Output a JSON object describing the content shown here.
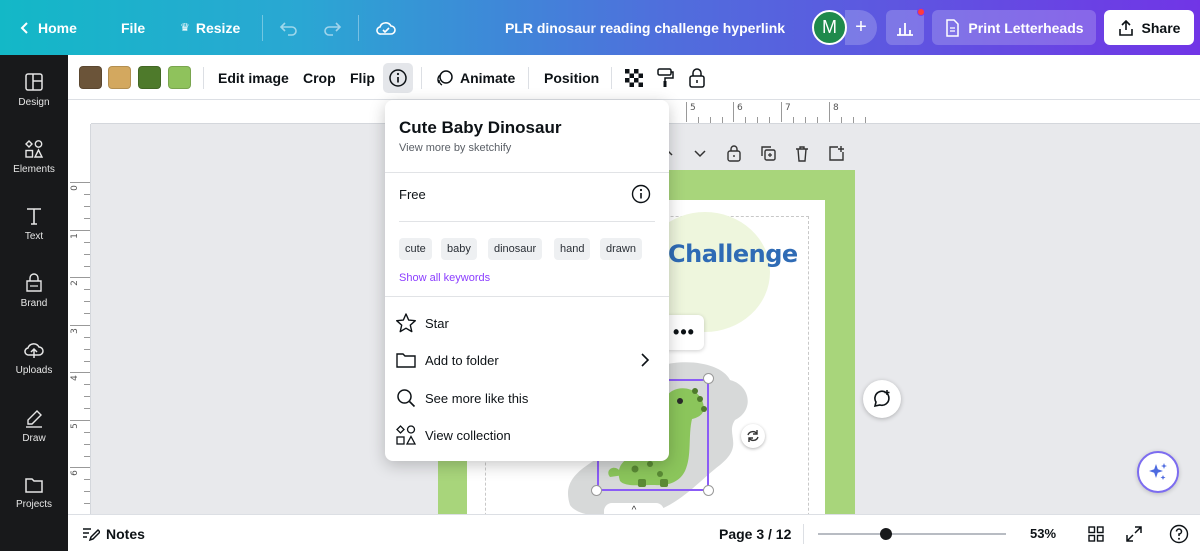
{
  "topbar": {
    "home_label": "Home",
    "file_label": "File",
    "resize_label": "Resize",
    "doc_title": "PLR dinosaur reading challenge hyperlink",
    "avatar_initial": "M",
    "print_label": "Print Letterheads",
    "share_label": "Share"
  },
  "sidebar": {
    "items": [
      {
        "label": "Design",
        "icon": "design-icon"
      },
      {
        "label": "Elements",
        "icon": "elements-icon"
      },
      {
        "label": "Text",
        "icon": "text-icon"
      },
      {
        "label": "Brand",
        "icon": "brand-icon"
      },
      {
        "label": "Uploads",
        "icon": "uploads-icon"
      },
      {
        "label": "Draw",
        "icon": "draw-icon"
      },
      {
        "label": "Projects",
        "icon": "projects-icon"
      }
    ]
  },
  "context_toolbar": {
    "swatches": [
      "#6b5439",
      "#d3a85f",
      "#4e7a2b",
      "#8fc25c"
    ],
    "edit_image_label": "Edit image",
    "crop_label": "Crop",
    "flip_label": "Flip",
    "animate_label": "Animate",
    "position_label": "Position"
  },
  "rulers": {
    "top": [
      "5",
      "6",
      "7",
      "8"
    ],
    "left": [
      "0",
      "1",
      "2",
      "3",
      "4",
      "5",
      "6"
    ]
  },
  "canvas": {
    "heading_text": "Challenge",
    "more_label": "•••",
    "collapse_label": "^"
  },
  "popup": {
    "title": "Cute Baby Dinosaur",
    "subtitle": "View more by sketchify",
    "license": "Free",
    "keywords": [
      "cute",
      "baby",
      "dinosaur",
      "hand",
      "drawn"
    ],
    "show_keywords_label": "Show all keywords",
    "actions": [
      {
        "label": "Star",
        "icon": "star-icon"
      },
      {
        "label": "Add to folder",
        "icon": "folder-icon"
      },
      {
        "label": "See more like this",
        "icon": "search-icon"
      },
      {
        "label": "View collection",
        "icon": "collection-icon"
      }
    ]
  },
  "bottombar": {
    "notes_label": "Notes",
    "page_indicator": "Page 3 / 12",
    "zoom_label": "53%",
    "zoom_level": 0.53
  },
  "colors": {
    "accent": "#8b3dff",
    "selection": "#8b5cf6",
    "page_border": "#a8d57b",
    "heading": "#2f6bb5"
  }
}
